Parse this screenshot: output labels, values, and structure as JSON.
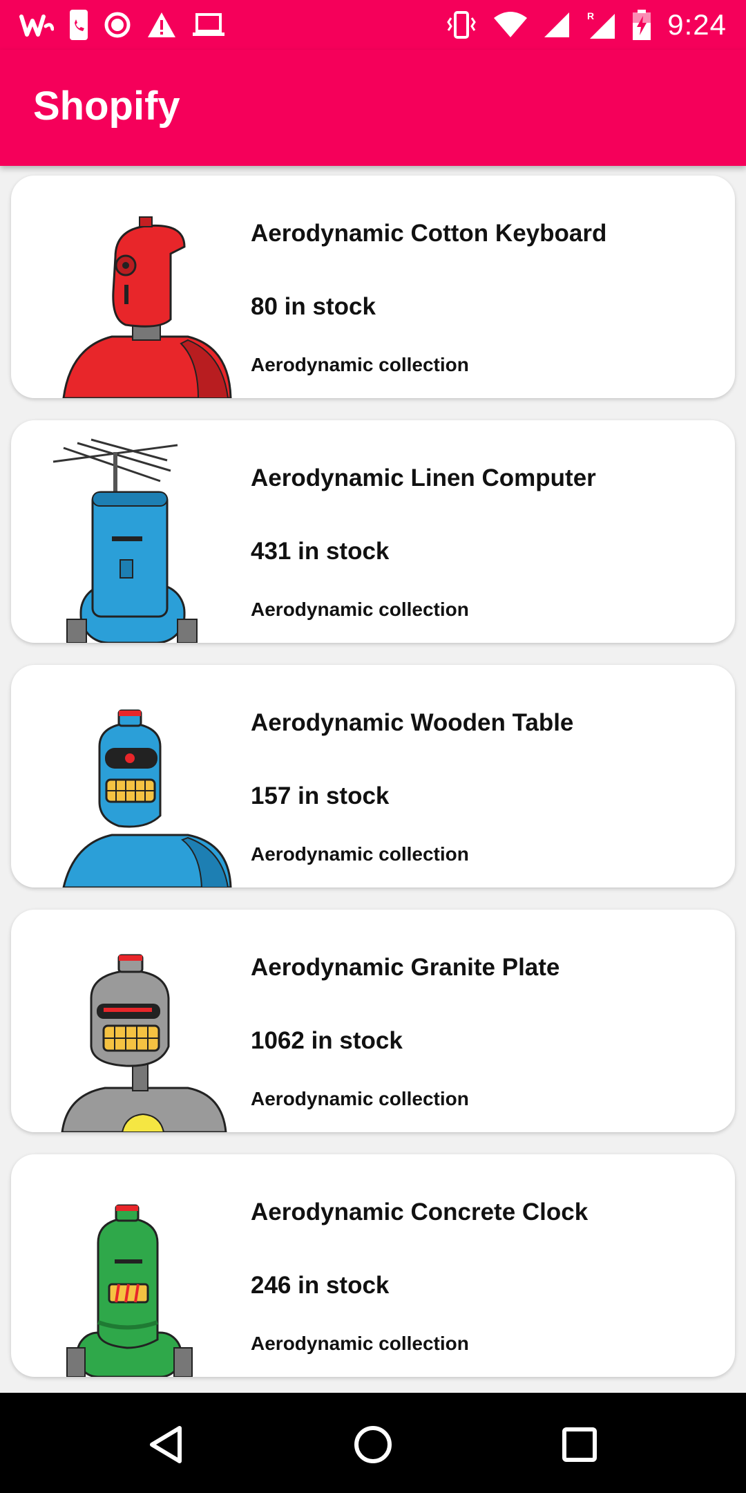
{
  "status_bar": {
    "time": "9:24",
    "left_icons": [
      "wattpad-icon",
      "phone-icon",
      "circle-notification-icon",
      "warning-icon",
      "laptop-icon"
    ],
    "right_icons": [
      "vibrate-icon",
      "wifi-icon",
      "signal-icon",
      "signal-roaming-icon",
      "battery-charging-icon"
    ]
  },
  "app_bar": {
    "title": "Shopify",
    "color": "#f5005a"
  },
  "products": [
    {
      "title": "Aerodynamic Cotton Keyboard",
      "stock": "80 in stock",
      "collection": "Aerodynamic collection",
      "robot_color": "#e8262a"
    },
    {
      "title": "Aerodynamic Linen Computer",
      "stock": "431 in stock",
      "collection": "Aerodynamic collection",
      "robot_color": "#2b9fd8"
    },
    {
      "title": "Aerodynamic Wooden Table",
      "stock": "157 in stock",
      "collection": "Aerodynamic collection",
      "robot_color": "#2b9fd8"
    },
    {
      "title": "Aerodynamic Granite Plate",
      "stock": "1062 in stock",
      "collection": "Aerodynamic collection",
      "robot_color": "#9a9a9a"
    },
    {
      "title": "Aerodynamic Concrete Clock",
      "stock": "246 in stock",
      "collection": "Aerodynamic collection",
      "robot_color": "#2fa84a"
    }
  ],
  "nav_bar": {
    "buttons": [
      "back-icon",
      "home-icon",
      "recents-icon"
    ]
  }
}
